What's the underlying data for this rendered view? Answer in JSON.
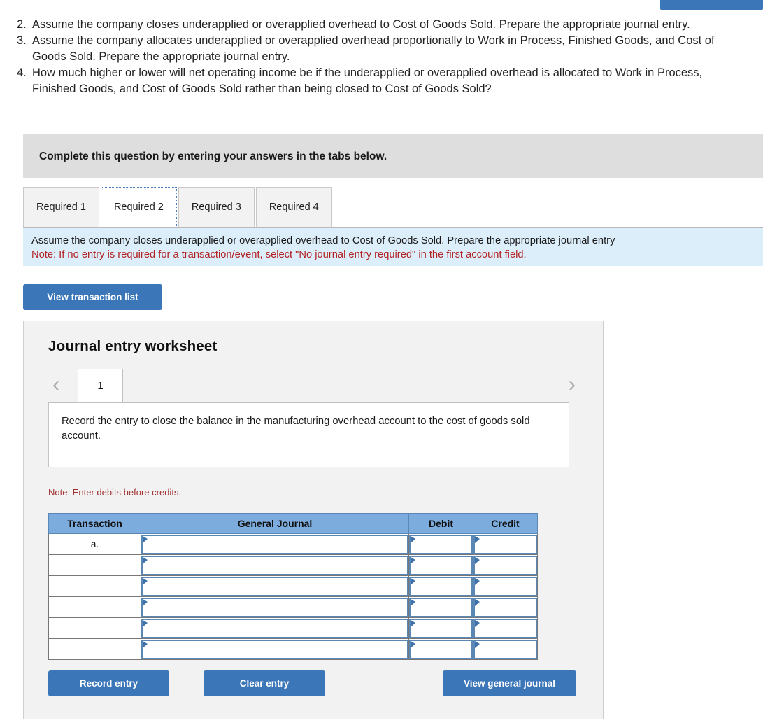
{
  "top_right_button": {
    "label": ""
  },
  "questions": [
    {
      "num": "2.",
      "text": "Assume the company closes underapplied or overapplied overhead to Cost of Goods Sold. Prepare the appropriate journal entry."
    },
    {
      "num": "3.",
      "text": "Assume the company allocates underapplied or overapplied overhead proportionally to Work in Process, Finished Goods, and Cost of Goods Sold. Prepare the appropriate journal entry."
    },
    {
      "num": "4.",
      "text": "How much higher or lower will net operating income be if the underapplied or overapplied overhead is allocated to Work in Process, Finished Goods, and Cost of Goods Sold rather than being closed to Cost of Goods Sold?"
    }
  ],
  "complete_banner": {
    "text": "Complete this question by entering your answers in the tabs below."
  },
  "tabs": [
    {
      "label": "Required 1",
      "active": false
    },
    {
      "label": "Required 2",
      "active": true
    },
    {
      "label": "Required 3",
      "active": false
    },
    {
      "label": "Required 4",
      "active": false
    }
  ],
  "info_banner": {
    "line1": "Assume the company closes underapplied or overapplied overhead to Cost of Goods Sold. Prepare the appropriate journal entry",
    "line2": "Note: If no entry is required for a transaction/event, select \"No journal entry required\" in the first account field."
  },
  "buttons": {
    "view_transaction_list": "View transaction list",
    "record_entry": "Record entry",
    "clear_entry": "Clear entry",
    "view_general_journal": "View general journal"
  },
  "worksheet": {
    "title": "Journal entry worksheet",
    "pager": {
      "prev_icon": "‹",
      "next_icon": "›",
      "current_page": "1"
    },
    "description": "Record the entry to close the balance in the manufacturing overhead account to the cost of goods sold account.",
    "note": "Note: Enter debits before credits.",
    "table": {
      "columns": [
        "Transaction",
        "General Journal",
        "Debit",
        "Credit"
      ],
      "rows": [
        {
          "transaction": "a.",
          "general_journal": "",
          "debit": "",
          "credit": ""
        },
        {
          "transaction": "",
          "general_journal": "",
          "debit": "",
          "credit": ""
        },
        {
          "transaction": "",
          "general_journal": "",
          "debit": "",
          "credit": ""
        },
        {
          "transaction": "",
          "general_journal": "",
          "debit": "",
          "credit": ""
        },
        {
          "transaction": "",
          "general_journal": "",
          "debit": "",
          "credit": ""
        },
        {
          "transaction": "",
          "general_journal": "",
          "debit": "",
          "credit": ""
        }
      ]
    }
  },
  "colors": {
    "primary_blue": "#3b76b8",
    "table_header_blue": "#7cacde",
    "info_banner_blue": "#ddeefb",
    "banner_gray": "#dedede",
    "panel_gray": "#f2f2f2",
    "note_red": "#b22222"
  }
}
